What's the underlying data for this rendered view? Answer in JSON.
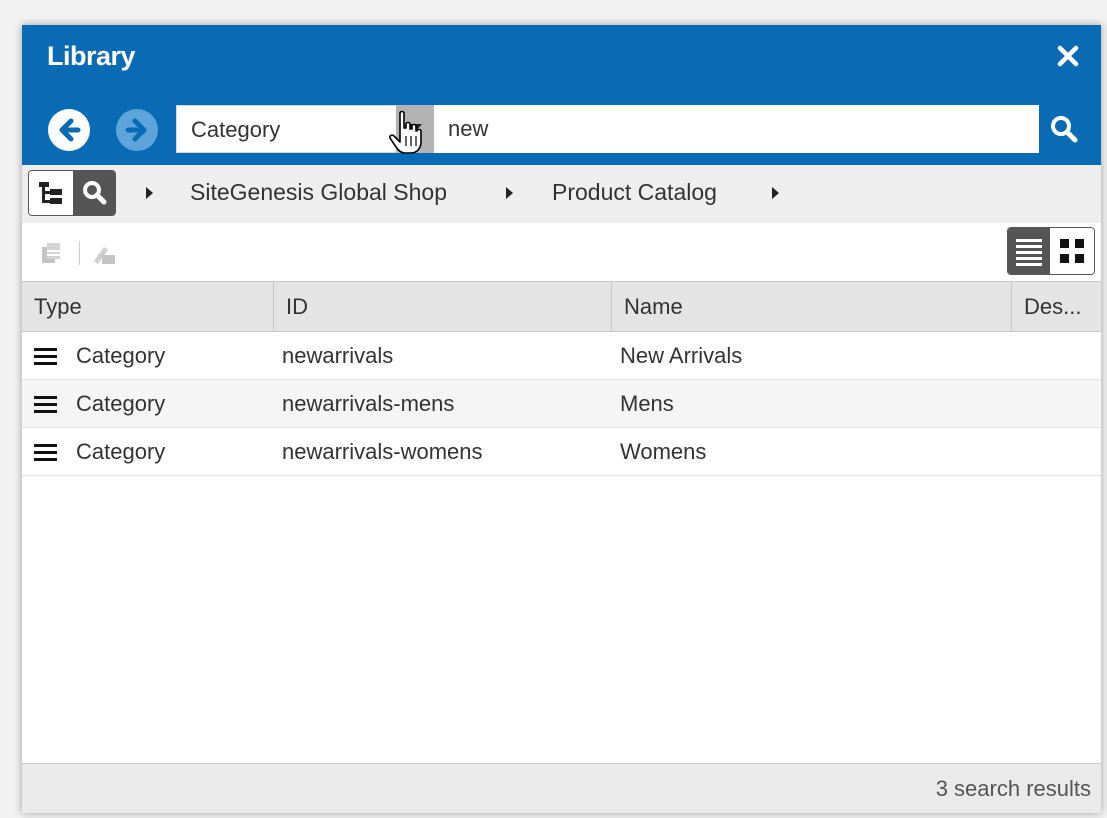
{
  "header": {
    "title": "Library",
    "close_icon": "close-icon",
    "back_icon": "arrow-left-circle-icon",
    "forward_icon": "arrow-right-circle-icon",
    "brand_color": "#0a6bb5"
  },
  "search": {
    "scope_selected": "Category",
    "query_value": "new",
    "search_icon": "search-icon"
  },
  "breadcrumb": {
    "mode_icons": [
      "tree-icon",
      "search-icon"
    ],
    "items": [
      "SiteGenesis Global Shop",
      "Product Catalog"
    ]
  },
  "toolbar": {
    "icons": [
      "copy-icon",
      "edit-icon"
    ],
    "view_icons": [
      "list-view-icon",
      "grid-view-icon"
    ]
  },
  "table": {
    "columns": [
      "Type",
      "ID",
      "Name",
      "Des..."
    ],
    "rows": [
      {
        "type": "Category",
        "id": "newarrivals",
        "name": "New Arrivals",
        "description": ""
      },
      {
        "type": "Category",
        "id": "newarrivals-mens",
        "name": "Mens",
        "description": ""
      },
      {
        "type": "Category",
        "id": "newarrivals-womens",
        "name": "Womens",
        "description": ""
      }
    ]
  },
  "footer": {
    "status": "3 search results"
  }
}
